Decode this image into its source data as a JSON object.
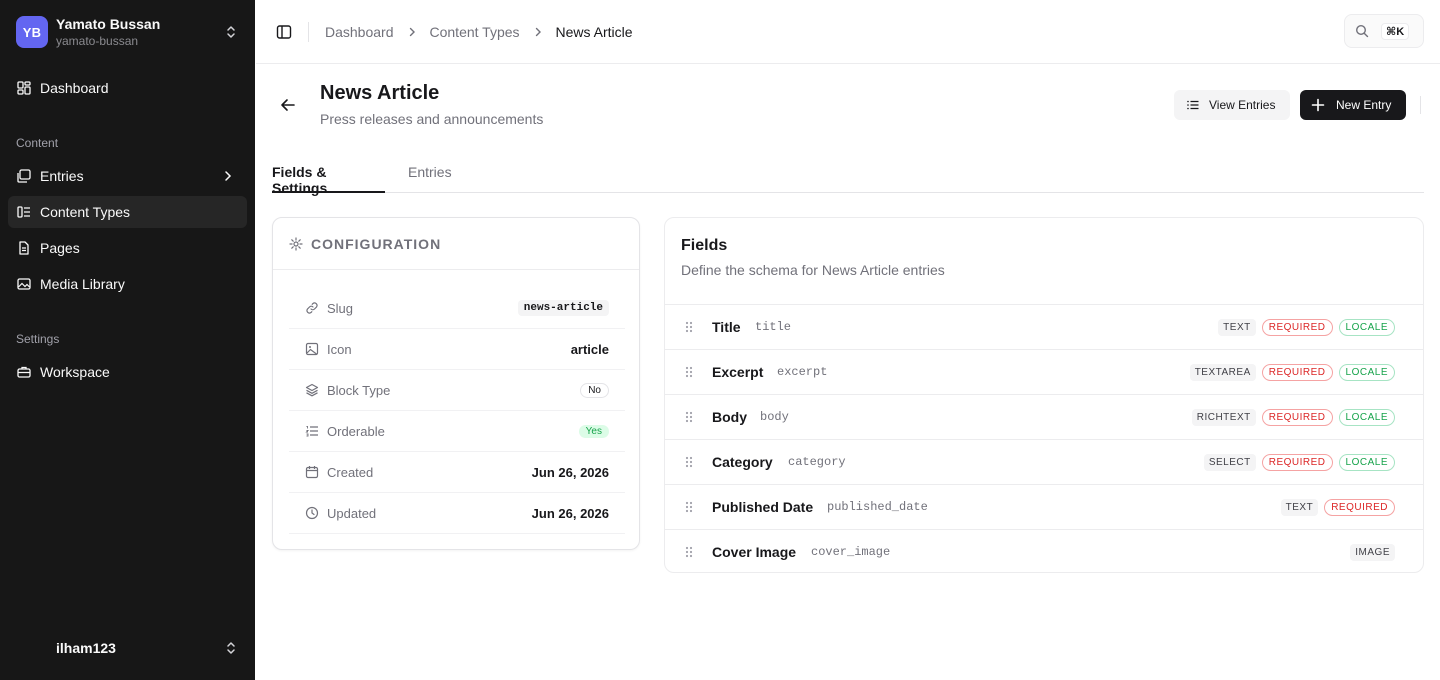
{
  "workspace": {
    "initials": "YB",
    "name": "Yamato Bussan",
    "slug": "yamato-bussan"
  },
  "sidebar": {
    "dashboard": "Dashboard",
    "content_label": "Content",
    "content_items": [
      "Entries",
      "Content Types",
      "Pages",
      "Media Library"
    ],
    "settings_label": "Settings",
    "settings_items": [
      "Workspace"
    ],
    "user": "ilham123"
  },
  "breadcrumb": [
    "Dashboard",
    "Content Types",
    "News Article"
  ],
  "search": {
    "shortcut": "⌘K"
  },
  "page": {
    "title": "News Article",
    "subtitle": "Press releases and announcements",
    "view_entries": "View Entries",
    "new_entry": "New Entry"
  },
  "tabs": [
    "Fields & Settings",
    "Entries"
  ],
  "config": {
    "heading": "CONFIGURATION",
    "rows": [
      {
        "key": "Slug",
        "value": "news-article"
      },
      {
        "key": "Icon",
        "value": "article"
      },
      {
        "key": "Block Type",
        "value": "No"
      },
      {
        "key": "Orderable",
        "value": "Yes"
      },
      {
        "key": "Created",
        "value": "Jun 26, 2026"
      },
      {
        "key": "Updated",
        "value": "Jun 26, 2026"
      }
    ]
  },
  "fields": {
    "title": "Fields",
    "subtitle": "Define the schema for News Article entries",
    "rows": [
      {
        "name": "Title",
        "key": "title",
        "type": "TEXT",
        "required": "REQUIRED",
        "locale": "LOCALE"
      },
      {
        "name": "Excerpt",
        "key": "excerpt",
        "type": "TEXTAREA",
        "required": "REQUIRED",
        "locale": "LOCALE"
      },
      {
        "name": "Body",
        "key": "body",
        "type": "RICHTEXT",
        "required": "REQUIRED",
        "locale": "LOCALE"
      },
      {
        "name": "Category",
        "key": "category",
        "type": "SELECT",
        "required": "REQUIRED",
        "locale": "LOCALE"
      },
      {
        "name": "Published Date",
        "key": "published_date",
        "type": "TEXT",
        "required": "REQUIRED"
      },
      {
        "name": "Cover Image",
        "key": "cover_image",
        "type": "IMAGE"
      }
    ]
  }
}
